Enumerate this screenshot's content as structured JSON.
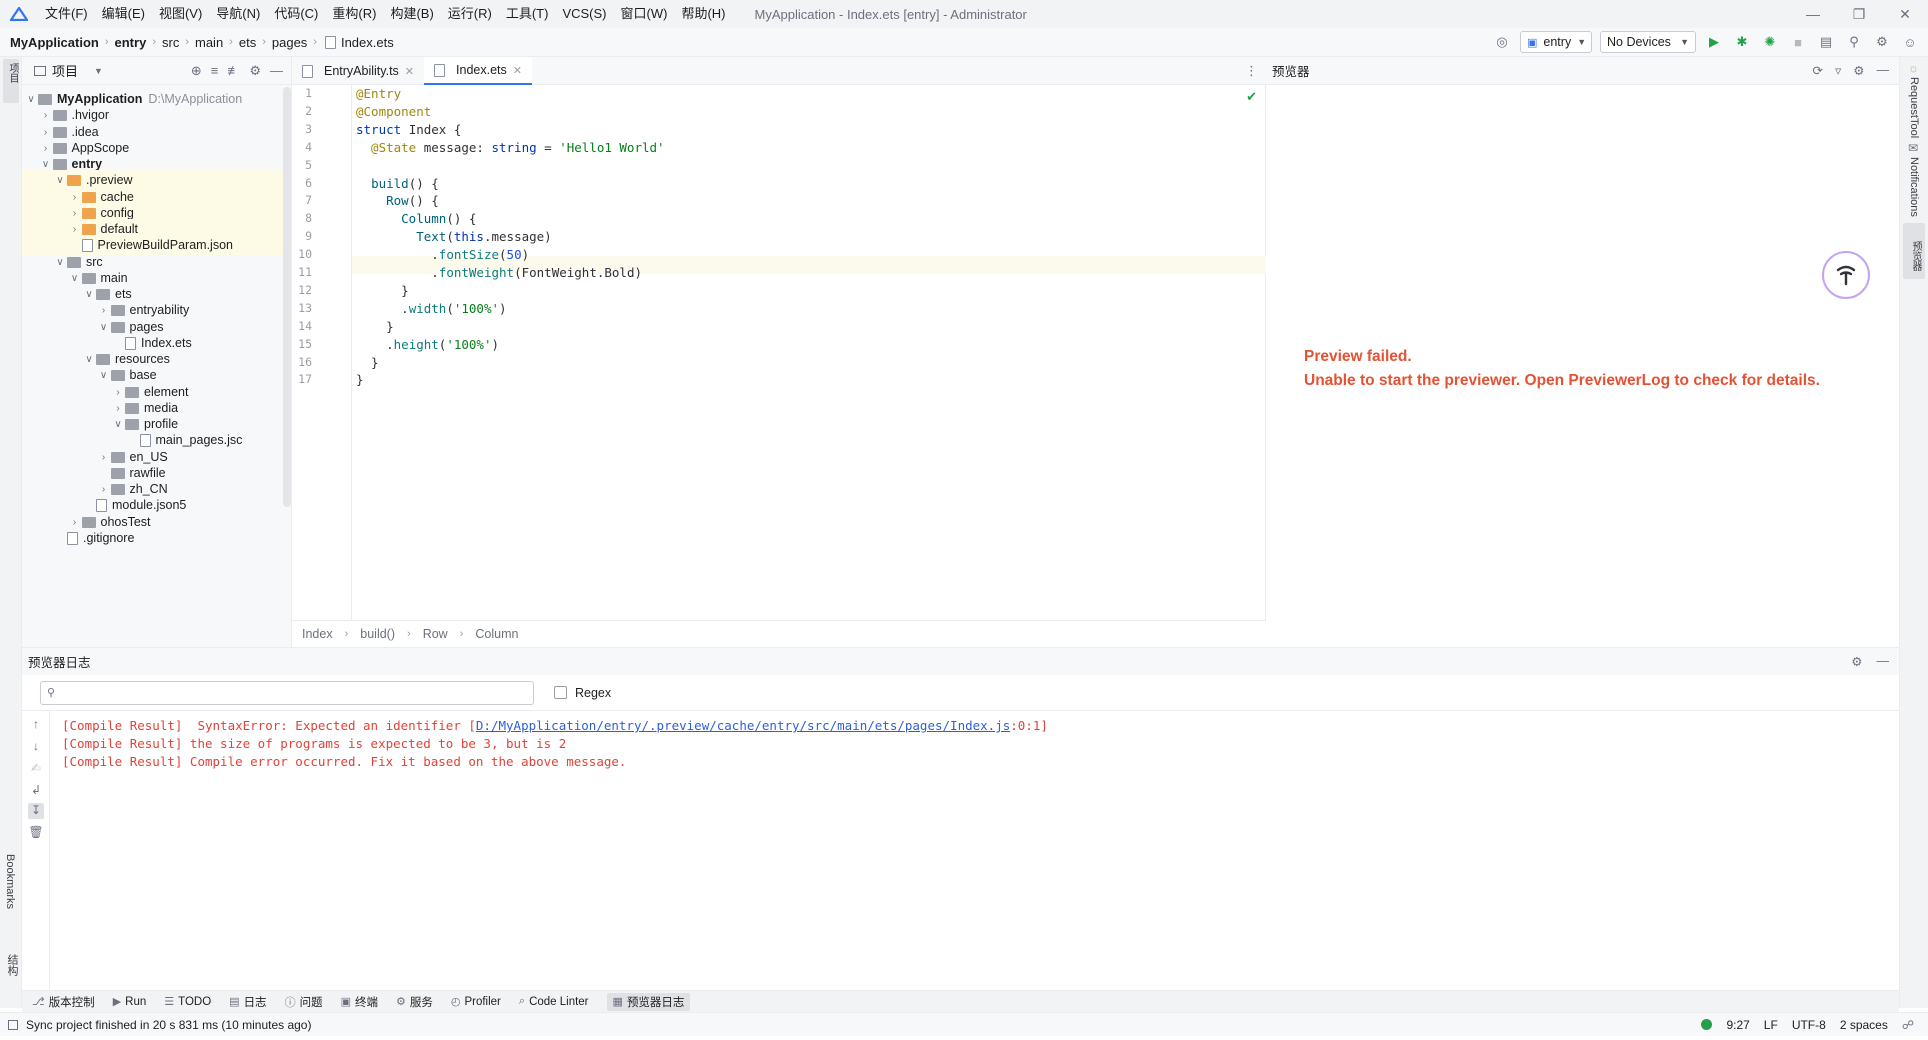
{
  "window": {
    "title": "MyApplication - Index.ets [entry] - Administrator",
    "menu": [
      "文件(F)",
      "编辑(E)",
      "视图(V)",
      "导航(N)",
      "代码(C)",
      "重构(R)",
      "构建(B)",
      "运行(R)",
      "工具(T)",
      "VCS(S)",
      "窗口(W)",
      "帮助(H)"
    ]
  },
  "nav": {
    "breadcrumbs": [
      "MyApplication",
      "entry",
      "src",
      "main",
      "ets",
      "pages",
      "Index.ets"
    ],
    "module_select": "entry",
    "device_select": "No Devices"
  },
  "left_stripe": {
    "project_label": "项目"
  },
  "project": {
    "title": "项目",
    "tree": [
      {
        "label": "MyApplication",
        "suffix": "D:\\MyApplication",
        "depth": 0,
        "open": true,
        "kind": "folder-gray",
        "bold": true
      },
      {
        "label": ".hvigor",
        "depth": 1,
        "open": false,
        "kind": "folder-gray"
      },
      {
        "label": ".idea",
        "depth": 1,
        "open": false,
        "kind": "folder-gray"
      },
      {
        "label": "AppScope",
        "depth": 1,
        "open": false,
        "kind": "folder-gray"
      },
      {
        "label": "entry",
        "depth": 1,
        "open": true,
        "kind": "folder-gray",
        "bold": true
      },
      {
        "label": ".preview",
        "depth": 2,
        "open": true,
        "kind": "folder-orange",
        "hl": true
      },
      {
        "label": "cache",
        "depth": 3,
        "open": false,
        "kind": "folder-orange",
        "hl": true
      },
      {
        "label": "config",
        "depth": 3,
        "open": false,
        "kind": "folder-orange",
        "hl": true
      },
      {
        "label": "default",
        "depth": 3,
        "open": false,
        "kind": "folder-orange",
        "hl": true
      },
      {
        "label": "PreviewBuildParam.json",
        "depth": 3,
        "kind": "file",
        "hl": true
      },
      {
        "label": "src",
        "depth": 2,
        "open": true,
        "kind": "folder-gray"
      },
      {
        "label": "main",
        "depth": 3,
        "open": true,
        "kind": "folder-gray"
      },
      {
        "label": "ets",
        "depth": 4,
        "open": true,
        "kind": "folder-gray"
      },
      {
        "label": "entryability",
        "depth": 5,
        "open": false,
        "kind": "folder-gray"
      },
      {
        "label": "pages",
        "depth": 5,
        "open": true,
        "kind": "folder-gray"
      },
      {
        "label": "Index.ets",
        "depth": 6,
        "kind": "file"
      },
      {
        "label": "resources",
        "depth": 4,
        "open": true,
        "kind": "folder-gray"
      },
      {
        "label": "base",
        "depth": 5,
        "open": true,
        "kind": "folder-gray"
      },
      {
        "label": "element",
        "depth": 6,
        "open": false,
        "kind": "folder-gray"
      },
      {
        "label": "media",
        "depth": 6,
        "open": false,
        "kind": "folder-gray"
      },
      {
        "label": "profile",
        "depth": 6,
        "open": true,
        "kind": "folder-gray"
      },
      {
        "label": "main_pages.jsc",
        "depth": 7,
        "kind": "file"
      },
      {
        "label": "en_US",
        "depth": 5,
        "open": false,
        "kind": "folder-gray"
      },
      {
        "label": "rawfile",
        "depth": 5,
        "kind": "folder-gray"
      },
      {
        "label": "zh_CN",
        "depth": 5,
        "open": false,
        "kind": "folder-gray"
      },
      {
        "label": "module.json5",
        "depth": 4,
        "kind": "file"
      },
      {
        "label": "ohosTest",
        "depth": 3,
        "open": false,
        "kind": "folder-gray"
      },
      {
        "label": ".gitignore",
        "depth": 2,
        "kind": "file"
      }
    ]
  },
  "editor": {
    "tabs": [
      {
        "label": "EntryAbility.ts",
        "active": false
      },
      {
        "label": "Index.ets",
        "active": true
      }
    ],
    "line_numbers": [
      "1",
      "2",
      "3",
      "4",
      "5",
      "6",
      "7",
      "8",
      "9",
      "10",
      "11",
      "12",
      "13",
      "14",
      "15",
      "16",
      "17"
    ],
    "code_lines": [
      [
        {
          "t": "@Entry",
          "c": "dec"
        }
      ],
      [
        {
          "t": "@Component",
          "c": "dec"
        }
      ],
      [
        {
          "t": "struct ",
          "c": "kw"
        },
        {
          "t": "Index {",
          "c": "pl"
        }
      ],
      [
        {
          "t": "  @State ",
          "c": "dec"
        },
        {
          "t": "message: ",
          "c": "pl"
        },
        {
          "t": "string",
          "c": "kw"
        },
        {
          "t": " = ",
          "c": "pl"
        },
        {
          "t": "'Hello1 World'",
          "c": "str"
        }
      ],
      [
        {
          "t": "",
          "c": "pl"
        }
      ],
      [
        {
          "t": "  ",
          "c": "pl"
        },
        {
          "t": "build",
          "c": "fn"
        },
        {
          "t": "() {",
          "c": "pl"
        }
      ],
      [
        {
          "t": "    ",
          "c": "pl"
        },
        {
          "t": "Row",
          "c": "fn"
        },
        {
          "t": "() {",
          "c": "pl"
        }
      ],
      [
        {
          "t": "      ",
          "c": "pl"
        },
        {
          "t": "Column",
          "c": "fn"
        },
        {
          "t": "() {",
          "c": "pl"
        }
      ],
      [
        {
          "t": "        ",
          "c": "pl"
        },
        {
          "t": "Text",
          "c": "fn"
        },
        {
          "t": "(",
          "c": "pl"
        },
        {
          "t": "this",
          "c": "kw"
        },
        {
          "t": ".message)",
          "c": "pl"
        }
      ],
      [
        {
          "t": "          .",
          "c": "pl"
        },
        {
          "t": "fontSize",
          "c": "mth"
        },
        {
          "t": "(",
          "c": "pl"
        },
        {
          "t": "50",
          "c": "num"
        },
        {
          "t": ")",
          "c": "pl"
        }
      ],
      [
        {
          "t": "          .",
          "c": "pl"
        },
        {
          "t": "fontWeight",
          "c": "mth"
        },
        {
          "t": "(FontWeight.Bold)",
          "c": "pl"
        }
      ],
      [
        {
          "t": "      }",
          "c": "pl"
        }
      ],
      [
        {
          "t": "      .",
          "c": "pl"
        },
        {
          "t": "width",
          "c": "mth"
        },
        {
          "t": "(",
          "c": "pl"
        },
        {
          "t": "'100%'",
          "c": "str"
        },
        {
          "t": ")",
          "c": "pl"
        }
      ],
      [
        {
          "t": "    }",
          "c": "pl"
        }
      ],
      [
        {
          "t": "    .",
          "c": "pl"
        },
        {
          "t": "height",
          "c": "mth"
        },
        {
          "t": "(",
          "c": "pl"
        },
        {
          "t": "'100%'",
          "c": "str"
        },
        {
          "t": ")",
          "c": "pl"
        }
      ],
      [
        {
          "t": "  }",
          "c": "pl"
        }
      ],
      [
        {
          "t": "}",
          "c": "pl"
        }
      ]
    ],
    "breadcrumbs": [
      "Index",
      "build()",
      "Row",
      "Column"
    ]
  },
  "previewer": {
    "title": "预览器",
    "error_title": "Preview failed.",
    "error_detail": "Unable to start the previewer. Open PreviewerLog to check for details."
  },
  "right_stripe": {
    "items": [
      "RequestTool",
      "Notifications",
      "预览器"
    ]
  },
  "log": {
    "title": "预览器日志",
    "search_placeholder": "",
    "regex_label": "Regex",
    "lines": [
      {
        "prefix": "[Compile Result]  SyntaxError: Expected an identifier [",
        "link": "D:/MyApplication/entry/.preview/cache/entry/src/main/ets/pages/Index.js",
        "suffix": ":0:1]"
      },
      {
        "prefix": "[Compile Result] the size of programs is expected to be 3, but is 2",
        "link": "",
        "suffix": ""
      },
      {
        "prefix": "[Compile Result] Compile error occurred. Fix it based on the above message.",
        "link": "",
        "suffix": ""
      }
    ],
    "side_labels": [
      "Bookmarks",
      "结构"
    ]
  },
  "tool_windows": [
    {
      "label": "版本控制",
      "icon": "vcs-icon"
    },
    {
      "label": "Run",
      "icon": "run-icon"
    },
    {
      "label": "TODO",
      "icon": "todo-icon"
    },
    {
      "label": "日志",
      "icon": "log-icon"
    },
    {
      "label": "问题",
      "icon": "problems-icon"
    },
    {
      "label": "终端",
      "icon": "terminal-icon"
    },
    {
      "label": "服务",
      "icon": "services-icon"
    },
    {
      "label": "Profiler",
      "icon": "profiler-icon"
    },
    {
      "label": "Code Linter",
      "icon": "linter-icon"
    },
    {
      "label": "预览器日志",
      "icon": "previewer-log-icon",
      "active": true
    }
  ],
  "status": {
    "message": "Sync project finished in 20 s 831 ms (10 minutes ago)",
    "position": "9:27",
    "line_ending": "LF",
    "encoding": "UTF-8",
    "indent": "2 spaces"
  },
  "colors": {
    "accent": "#3574f0",
    "error": "#e55233",
    "log_error": "#e0433a"
  }
}
